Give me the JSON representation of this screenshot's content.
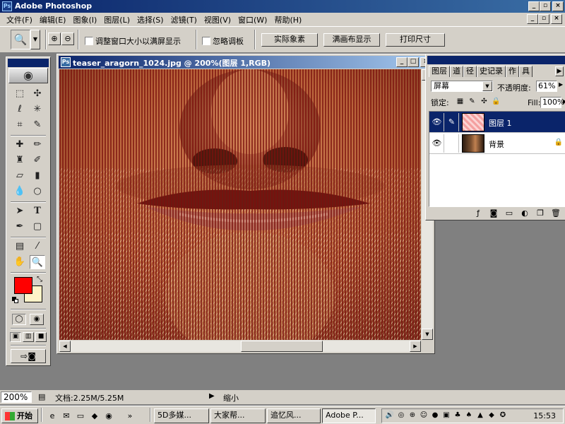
{
  "app": {
    "title": "Adobe Photoshop"
  },
  "menu": [
    "文件(F)",
    "编辑(E)",
    "图象(I)",
    "图层(L)",
    "选择(S)",
    "滤镜(T)",
    "视图(V)",
    "窗口(W)",
    "帮助(H)"
  ],
  "options": {
    "resize_windows": "调整窗口大小以满屏显示",
    "ignore_palettes": "忽略调板",
    "actual_pixels": "实际象素",
    "fit_screen": "满画布显示",
    "print_size": "打印尺寸"
  },
  "document": {
    "title": "teaser_aragorn_1024.jpg @ 200%(图层 1,RGB)",
    "stripe_color": "#7a0f0c"
  },
  "colors": {
    "foreground": "#ff0000",
    "background": "#fff3c8"
  },
  "layers_palette": {
    "tabs": [
      "图层",
      "道",
      "径",
      "史记录",
      "作",
      "具"
    ],
    "blend_mode": "屏幕",
    "opacity_label": "不透明度:",
    "opacity": "61%",
    "lock_label": "锁定:",
    "fill_label": "Fill:",
    "fill": "100%",
    "layers": [
      {
        "name": "图层 1",
        "selected": true
      },
      {
        "name": "背景",
        "selected": false
      }
    ]
  },
  "status": {
    "zoom": "200%",
    "doc_size": "文档:2.25M/5.25M",
    "hint": "缩小"
  },
  "taskbar": {
    "start": "开始",
    "tasks": [
      "5D多媒...",
      "大家帮...",
      "追忆风...",
      "Adobe P..."
    ],
    "clock": "15:53"
  }
}
